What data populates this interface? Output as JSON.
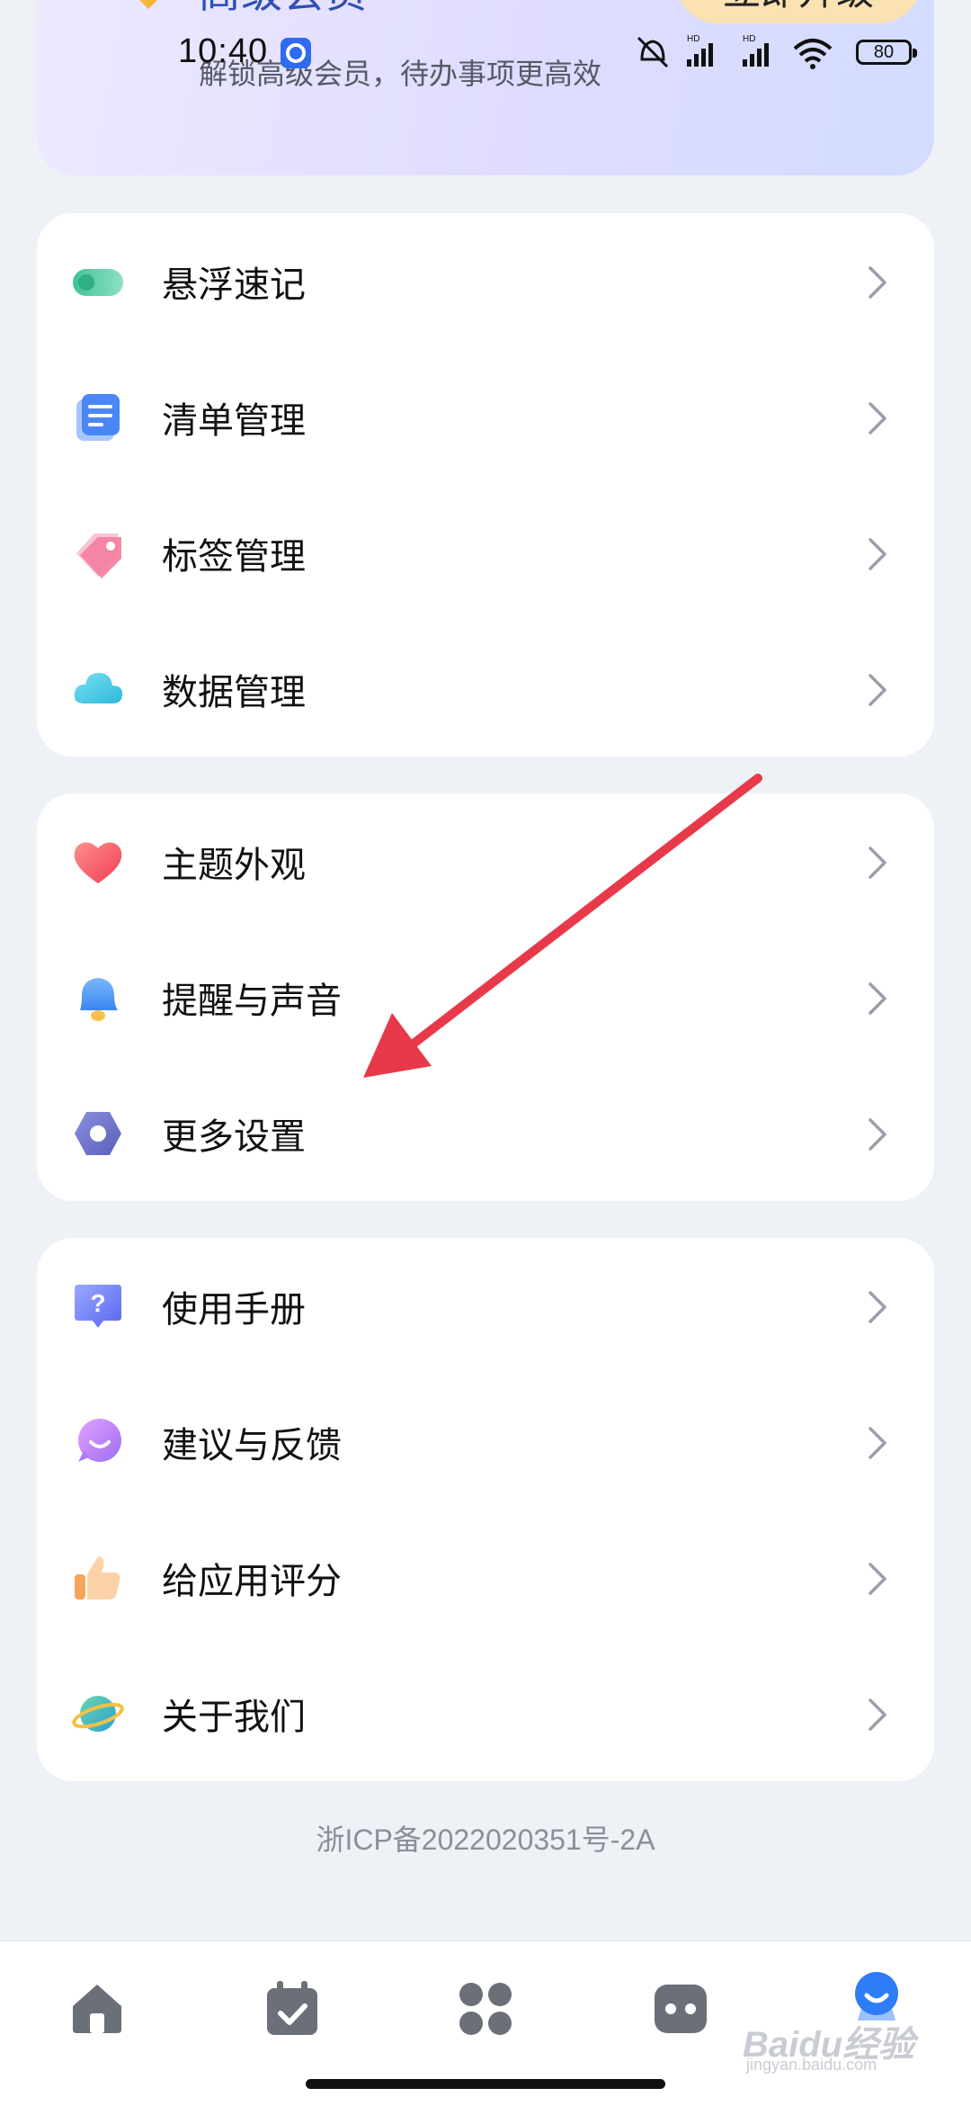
{
  "status_bar": {
    "time": "10:40",
    "battery": "80"
  },
  "vip": {
    "title": "高级会员",
    "subtitle": "解锁高级会员，待办事项更高效",
    "upgrade_label": "立即升级"
  },
  "groups": [
    {
      "items": [
        {
          "label": "悬浮速记",
          "icon": "floating-note-icon",
          "color": "#4ecf9c"
        },
        {
          "label": "清单管理",
          "icon": "list-icon",
          "color": "#4a86f5"
        },
        {
          "label": "标签管理",
          "icon": "tag-icon",
          "color": "#f47ea0"
        },
        {
          "label": "数据管理",
          "icon": "cloud-icon",
          "color": "#3fc9e6"
        }
      ]
    },
    {
      "items": [
        {
          "label": "主题外观",
          "icon": "heart-icon",
          "color": "#f25d66"
        },
        {
          "label": "提醒与声音",
          "icon": "bell-icon",
          "color": "#4a9bf5"
        },
        {
          "label": "更多设置",
          "icon": "gear-hex-icon",
          "color": "#6f74c8"
        }
      ]
    },
    {
      "items": [
        {
          "label": "使用手册",
          "icon": "help-icon",
          "color": "#6a7cf2"
        },
        {
          "label": "建议与反馈",
          "icon": "chat-icon",
          "color": "#c67cf0"
        },
        {
          "label": "给应用评分",
          "icon": "thumbs-up-icon",
          "color": "#f5b27a"
        },
        {
          "label": "关于我们",
          "icon": "planet-icon",
          "color": "#3fbf8f"
        }
      ]
    }
  ],
  "icp": "浙ICP备2022020351号-2A",
  "bottom_nav": [
    {
      "icon": "home-icon",
      "active": false
    },
    {
      "icon": "calendar-icon",
      "active": false
    },
    {
      "icon": "grid-icon",
      "active": false
    },
    {
      "icon": "dots-icon",
      "active": false
    },
    {
      "icon": "profile-icon",
      "active": true
    }
  ],
  "watermark": {
    "text": "Baidu经验",
    "sub": "jingyan.baidu.com"
  },
  "colors": {
    "brand_blue": "#2d4fb8",
    "upgrade_bg": "#fbe2b2",
    "nav_icon": "#6b6f78",
    "nav_active": "#2e7cf6",
    "annotation_arrow": "#e8394a"
  }
}
